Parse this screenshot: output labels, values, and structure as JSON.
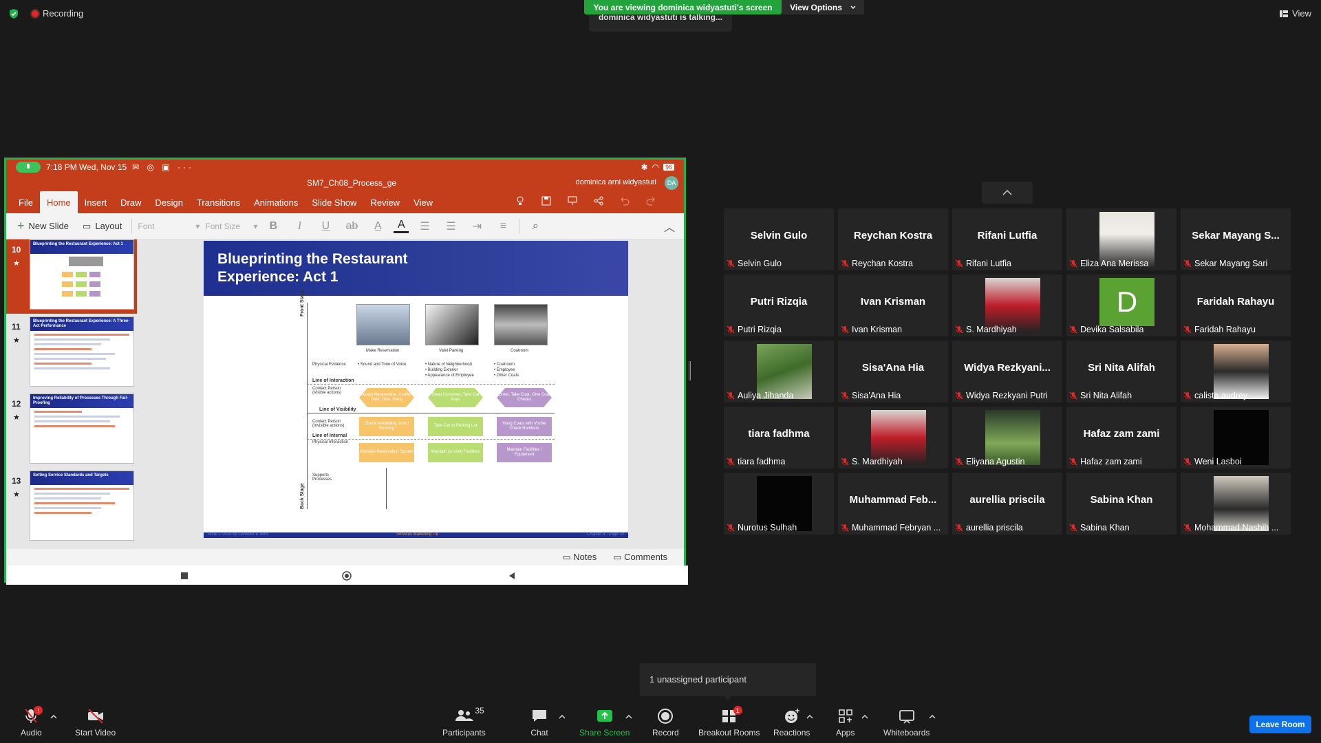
{
  "topbar": {
    "recording": "Recording",
    "viewing_banner": "You are viewing dominica widyastuti's screen",
    "view_options": "View Options",
    "talking": "dominica widyastuti is talking...",
    "view": "View"
  },
  "shared": {
    "status_time": "7:18 PM Wed, Nov 15",
    "battery": "96",
    "file_name": "SM7_Ch08_Process_ge",
    "user_name": "dominica arni widyasturi",
    "user_initials": "DA",
    "ribbon_tabs": [
      "File",
      "Home",
      "Insert",
      "Draw",
      "Design",
      "Transitions",
      "Animations",
      "Slide Show",
      "Review",
      "View"
    ],
    "toolbar": {
      "new_slide": "New Slide",
      "layout": "Layout",
      "font": "Font",
      "font_size": "Font Size"
    },
    "thumbnails": [
      {
        "num": "10",
        "title": "Blueprinting the Restaurant Experience: Act 1"
      },
      {
        "num": "11",
        "title": "Blueprinting the Restaurant Experience: A Three-Act Performance"
      },
      {
        "num": "12",
        "title": "Improving Reliability of Processes Through Fail-Proofing"
      },
      {
        "num": "13",
        "title": "Setting Service Standards and Targets"
      }
    ],
    "thumb_star": "★",
    "slide": {
      "title_line1": "Blueprinting the Restaurant",
      "title_line2": "Experience: Act 1",
      "front_stage": "Front Stage",
      "back_stage": "Back Stage",
      "photos": [
        "Make Reservation",
        "Valet Parking",
        "Coatroom"
      ],
      "physical_evidence": "Physical Evidence",
      "pe_col1": "• Sound and Tone of Voice",
      "pe_col2": "• Nature of Neighborhood\n• Building Exterior\n• Appearance of Employee",
      "pe_col3": "• Coatroom\n• Employee\n• Other Coats",
      "line_interaction": "Line of Interaction",
      "contact_visible": "Contact Person (Visible actions)",
      "line_visibility": "Line of Visibility",
      "contact_invisible": "Contact Person (Invisible actions)",
      "line_internal": "Line of Internal",
      "physical_interaction": "Physical Interaction",
      "support": "Supports Processes",
      "s1": "Accept Reservation, Confirm Date, Time, Party",
      "s2": "Greet Customer, Take Car Keys",
      "s3": "Greet, Take Coat, Give Coat Checks",
      "s4": "Check Availability, Insert Booking",
      "s5": "Take Car to Parking Lot",
      "s6": "Hang Coats with Visible Check Numbers",
      "s7": "Maintain Reservation System",
      "s8": "Maintain (or rent) Facilities",
      "s9": "Maintain Facilities / Equipment",
      "footer_left": "Slide © 2010 by Lovelock & Wirtz",
      "footer_mid": "Services Marketing 7/e",
      "footer_right": "Chapter 8 - Page 10"
    },
    "notes": "Notes",
    "comments": "Comments"
  },
  "participants": [
    {
      "big": "Selvin Gulo",
      "name": "Selvin Gulo",
      "kind": "name"
    },
    {
      "big": "Reychan Kostra",
      "name": "Reychan Kostra",
      "kind": "name"
    },
    {
      "big": "Rifani Lutfia",
      "name": "Rifani Lutfia",
      "kind": "name"
    },
    {
      "big": "",
      "name": "Eliza Ana Merissa",
      "kind": "video"
    },
    {
      "big": "Sekar  Mayang  S...",
      "name": "Sekar Mayang Sari",
      "kind": "name"
    },
    {
      "big": "Putri Rizqia",
      "name": "Putri Rizqia",
      "kind": "name"
    },
    {
      "big": "Ivan Krisman",
      "name": "Ivan Krisman",
      "kind": "name"
    },
    {
      "big": "",
      "name": "S. Mardhiyah",
      "kind": "video"
    },
    {
      "big": "D",
      "name": "Devika Salsabila",
      "kind": "initial"
    },
    {
      "big": "Faridah Rahayu",
      "name": "Faridah Rahayu",
      "kind": "name"
    },
    {
      "big": "",
      "name": "Auliya Jihanda",
      "kind": "video"
    },
    {
      "big": "Sisa'Ana Hia",
      "name": "Sisa'Ana Hia",
      "kind": "name"
    },
    {
      "big": "Widya  Rezkyani...",
      "name": "Widya Rezkyani Putri",
      "kind": "name"
    },
    {
      "big": "Sri Nita Alifah",
      "name": "Sri Nita Alifah",
      "kind": "name"
    },
    {
      "big": "",
      "name": "calista audrey",
      "kind": "video"
    },
    {
      "big": "tiara fadhma",
      "name": "tiara fadhma",
      "kind": "name"
    },
    {
      "big": "",
      "name": "S. Mardhiyah",
      "kind": "video"
    },
    {
      "big": "",
      "name": "Eliyana Agustin",
      "kind": "video"
    },
    {
      "big": "Hafaz zam zami",
      "name": "Hafaz zam zami",
      "kind": "name"
    },
    {
      "big": "",
      "name": "Weni Lasboi",
      "kind": "black"
    },
    {
      "big": "",
      "name": "Nurotus Sulhah",
      "kind": "black"
    },
    {
      "big": "Muhammad  Feb...",
      "name": "Muhammad Febryan ...",
      "kind": "name"
    },
    {
      "big": "aurellia priscila",
      "name": "aurellia priscila",
      "kind": "name"
    },
    {
      "big": "Sabina Khan",
      "name": "Sabina Khan",
      "kind": "name"
    },
    {
      "big": "",
      "name": "Mohammad Nashih ...",
      "kind": "video"
    }
  ],
  "popup": "1 unassigned participant",
  "bottom": {
    "audio": "Audio",
    "audio_badge": "!",
    "start_video": "Start Video",
    "participants": "Participants",
    "participants_count": "35",
    "chat": "Chat",
    "share_screen": "Share Screen",
    "record": "Record",
    "breakout": "Breakout Rooms",
    "breakout_badge": "1",
    "reactions": "Reactions",
    "apps": "Apps",
    "whiteboards": "Whiteboards",
    "leave": "Leave Room"
  },
  "colors": {
    "ppt_accent": "#c43e1c",
    "share_border": "#22b14c",
    "banner": "#23a33c",
    "leave": "#0e72ed"
  }
}
